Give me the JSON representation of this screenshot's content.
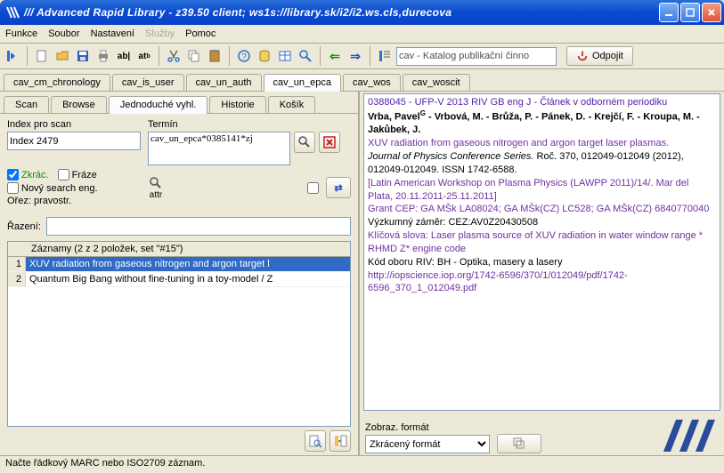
{
  "window": {
    "title": "/// Advanced Rapid Library - z39.50 client; ws1s://library.sk/i2/i2.ws.cls,durecova"
  },
  "menu": {
    "funkce": "Funkce",
    "soubor": "Soubor",
    "nastaveni": "Nastavení",
    "sluzby": "Služby",
    "pomoc": "Pomoc"
  },
  "toolbar": {
    "catalog_combo": "cav - Katalog publikační činno",
    "disconnect": "Odpojit"
  },
  "tabs": {
    "items": [
      {
        "label": "cav_cm_chronology",
        "active": false
      },
      {
        "label": "cav_is_user",
        "active": false
      },
      {
        "label": "cav_un_auth",
        "active": false
      },
      {
        "label": "cav_un_epca",
        "active": true
      },
      {
        "label": "cav_wos",
        "active": false
      },
      {
        "label": "cav_woscit",
        "active": false
      }
    ]
  },
  "subtabs": {
    "items": [
      {
        "label": "Scan",
        "active": false
      },
      {
        "label": "Browse",
        "active": false
      },
      {
        "label": "Jednoduché vyhl.",
        "active": true
      },
      {
        "label": "Historie",
        "active": false
      },
      {
        "label": "Košík",
        "active": false
      }
    ]
  },
  "scan": {
    "index_label": "Index pro scan",
    "index_value": "Index 2479",
    "term_label": "Termín",
    "term_value": "cav_un_epca*0385141*zj",
    "zkrac": "Zkrác.",
    "fraze": "Fráze",
    "novy": "Nový search eng.",
    "orez": "Ořez: pravostr.",
    "attr": "attr"
  },
  "razeni": {
    "label": "Řazení:"
  },
  "records": {
    "header": "Záznamy (2 z 2 položek, set \"#15\")",
    "rows": [
      {
        "n": "1",
        "txt": "XUV radiation from gaseous nitrogen and argon target l",
        "sel": true
      },
      {
        "n": "2",
        "txt": "Quantum Big Bang without fine-tuning in a toy-model / Z",
        "sel": false
      }
    ]
  },
  "detail": {
    "pubid": "0388045 - UFP-V 2013 RIV GB eng J - Článek v odborném periodiku",
    "authors_html": "Vrba, Pavel<sup>G</sup> - Vrbová, M. - Brůža, P. - Pánek, D. - Krejčí, F. - Kroupa, M. - Jakůbek, J.",
    "title": "XUV radiation from gaseous nitrogen and argon target laser plasmas.",
    "journal": "Journal of Physics Conference Series.",
    "journal_tail": " Roč. 370, 012049-012049 (2012), 012049-012049. ISSN 1742-6588.",
    "conf": "[Latin American Workshop on Plasma Physics (LAWPP 2011)/14/. Mar del Plata, 20.11.2011-25.11.2011]",
    "grant": "Grant CEP: GA MŠk LA08024; GA MŠk(CZ) LC528; GA MŠk(CZ) 6840770040",
    "vyz": "Výzkumný záměr: CEZ:AV0Z20430508",
    "kw": "Klíčová slova: Laser plasma source of XUV radiation in water window range * RHMD Z* engine code",
    "kod": "Kód oboru RIV: BH - Optika, masery a lasery",
    "url": "http://iopscience.iop.org/1742-6596/370/1/012049/pdf/1742-6596_370_1_012049.pdf"
  },
  "zobraz": {
    "label": "Zobraz. formát",
    "value": "Zkrácený formát"
  },
  "status": "Načte řádkový MARC nebo ISO2709 záznam."
}
